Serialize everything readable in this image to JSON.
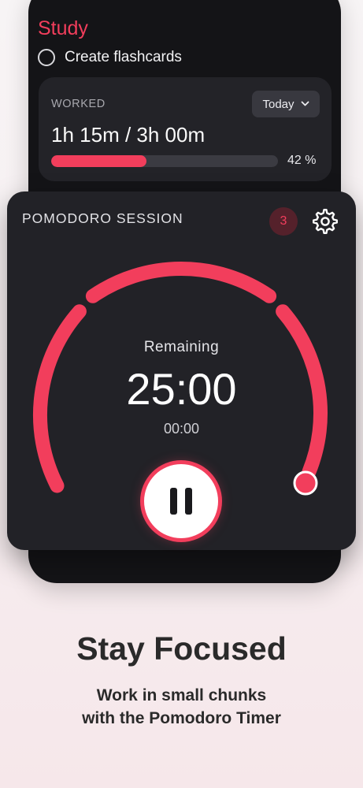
{
  "study": {
    "title": "Study",
    "task": "Create flashcards"
  },
  "worked": {
    "label": "WORKED",
    "period": "Today",
    "value": "1h 15m / 3h 00m",
    "progress_fraction": 0.42,
    "percent_label": "42 %"
  },
  "pomodoro": {
    "title": "POMODORO SESSION",
    "session_count": "3",
    "remaining_label": "Remaining",
    "remaining_time": "25:00",
    "elapsed_time": "00:00",
    "icons": {
      "settings": "gear-icon",
      "pause": "pause-icon",
      "dropdown": "chevron-down-icon"
    }
  },
  "promo": {
    "headline": "Stay Focused",
    "subline_1": "Work in small chunks",
    "subline_2": "with the Pomodoro Timer"
  },
  "colors": {
    "accent": "#f23e5c",
    "card_bg": "#222227",
    "phone_bg": "#141417",
    "badge_bg": "#55212b"
  }
}
